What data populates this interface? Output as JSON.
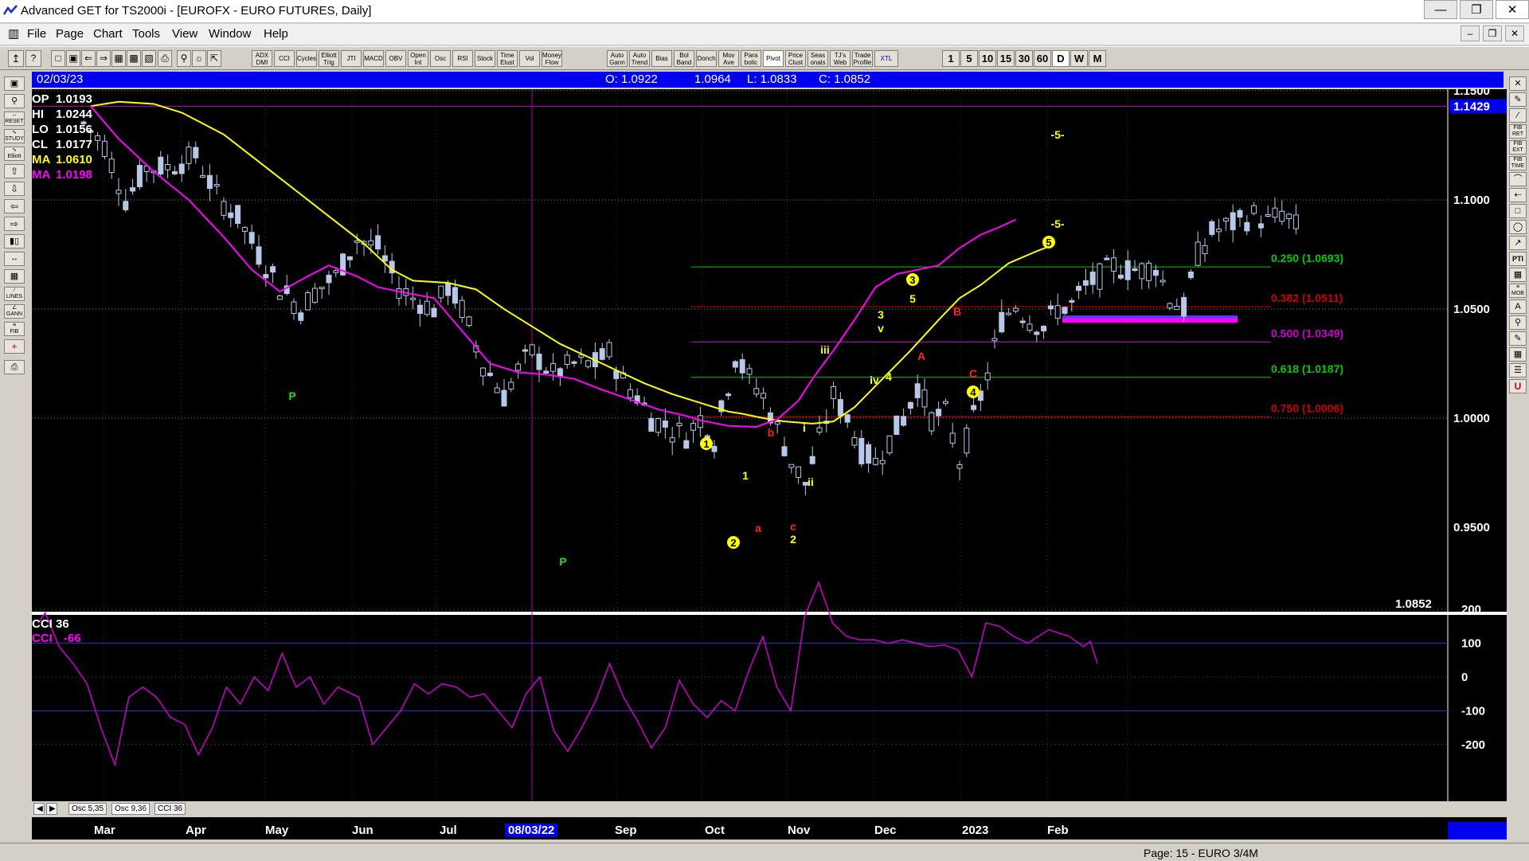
{
  "window": {
    "title": "Advanced GET for TS2000i - [EUROFX - EURO FUTURES, Daily]",
    "controls": [
      "minimize",
      "maximize",
      "close"
    ]
  },
  "menu": [
    "File",
    "Page",
    "Chart",
    "Tools",
    "View",
    "Window",
    "Help"
  ],
  "toolbar": {
    "studies": [
      "ADX DMI",
      "CCI",
      "Cycles",
      "Elliott Trig",
      "JTI",
      "MACD",
      "OBV",
      "Open Int",
      "Osc",
      "RSI",
      "Stock",
      "Time Elust",
      "Vol",
      "Money Flow",
      "Auto Gann",
      "Auto Trend",
      "Bias",
      "Bol Band",
      "Donch",
      "Mov Ave",
      "Para bolic",
      "Pivot",
      "Price Clust",
      "Seas onals",
      "TJ's Web",
      "Trade Profile",
      "XTL"
    ],
    "periods": [
      "1",
      "5",
      "10",
      "15",
      "30",
      "60",
      "D",
      "W",
      "M"
    ]
  },
  "info_bar": {
    "date": "02/03/23",
    "open_label": "O: 1.0922",
    "high_value": "1.0964",
    "low_label": "L: 1.0833",
    "close_label": "C: 1.0852"
  },
  "legend": [
    {
      "label": "OP",
      "value": "1.0193",
      "color": "#ffffff"
    },
    {
      "label": "HI",
      "value": "1.0244",
      "color": "#ffffff"
    },
    {
      "label": "LO",
      "value": "1.0156",
      "color": "#ffffff"
    },
    {
      "label": "CL",
      "value": "1.0177",
      "color": "#ffffff"
    },
    {
      "label": "MA",
      "value": "1.0610",
      "color": "#ffff00"
    },
    {
      "label": "MA",
      "value": "1.0198",
      "color": "#ff00ff"
    }
  ],
  "price_axis": {
    "ticks": [
      "1.1500",
      "1.1000",
      "1.0500",
      "1.0000",
      "0.9500"
    ],
    "marker": "1.1429",
    "last": "1.0852"
  },
  "fib_levels": [
    {
      "label": "0.250 (1.0693)",
      "color": "#00cc00"
    },
    {
      "label": "0.382 (1.0511)",
      "color": "#cc0000"
    },
    {
      "label": "0.500 (1.0349)",
      "color": "#cc00cc"
    },
    {
      "label": "0.618 (1.0187)",
      "color": "#00cc00"
    },
    {
      "label": "0.750 (1.0006)",
      "color": "#cc0000"
    }
  ],
  "wave_labels": {
    "five_top": "-5-",
    "five_mid": "-5-",
    "circle_5": "5",
    "circle_3": "3",
    "five_small": "5",
    "three_small": "3",
    "v_small": "v",
    "iii": "iii",
    "iv": "iv",
    "four_small": "4",
    "i_small": "i",
    "ii_small": "ii",
    "circle_1": "1",
    "one_small": "1",
    "circle_2": "2",
    "two_small": "2",
    "c_small": "c",
    "b_small": "b",
    "a_small": "a",
    "A": "A",
    "B": "B",
    "C": "C",
    "circle_4": "4",
    "P1": "P",
    "P2": "P"
  },
  "indicator": {
    "title": "CCI 36",
    "line_label": "CCI",
    "line_value": "-66",
    "ticks": [
      "200",
      "100",
      "0",
      "-100",
      "-200"
    ]
  },
  "osc_tabs": [
    "Osc 5,35",
    "Osc 9,36",
    "CCI 36"
  ],
  "months": [
    "Mar",
    "Apr",
    "May",
    "Jun",
    "Jul",
    "08/03/22",
    "Sep",
    "Oct",
    "Nov",
    "Dec",
    "2023",
    "Feb"
  ],
  "status": {
    "page": "Page: 15 - EURO 3/4M"
  },
  "chart_data": {
    "type": "candlestick",
    "price_ylim": [
      0.95,
      1.15
    ],
    "ma_yellow": [
      [
        1,
        1.143
      ],
      [
        5,
        1.145
      ],
      [
        10,
        1.144
      ],
      [
        14,
        1.14
      ],
      [
        20,
        1.13
      ],
      [
        24,
        1.12
      ],
      [
        28,
        1.11
      ],
      [
        32,
        1.1
      ],
      [
        36,
        1.09
      ],
      [
        40,
        1.08
      ],
      [
        44,
        1.068
      ],
      [
        47,
        1.063
      ],
      [
        52,
        1.062
      ],
      [
        56,
        1.059
      ],
      [
        60,
        1.05
      ],
      [
        64,
        1.042
      ],
      [
        68,
        1.034
      ],
      [
        72,
        1.028
      ],
      [
        76,
        1.022
      ],
      [
        80,
        1.016
      ],
      [
        84,
        1.011
      ],
      [
        88,
        1.007
      ],
      [
        92,
        1.003
      ],
      [
        94,
        1.002
      ],
      [
        97,
        1.0
      ],
      [
        100,
        0.9985
      ],
      [
        104,
        0.9975
      ],
      [
        107,
        0.9985
      ],
      [
        110,
        1.005
      ],
      [
        114,
        1.018
      ],
      [
        118,
        1.031
      ],
      [
        122,
        1.045
      ],
      [
        125,
        1.055
      ],
      [
        128,
        1.061
      ],
      [
        132,
        1.071
      ],
      [
        136,
        1.0765
      ],
      [
        138,
        1.079
      ]
    ],
    "ma_magenta": [
      [
        1,
        1.143
      ],
      [
        5,
        1.128
      ],
      [
        10,
        1.113
      ],
      [
        15,
        1.1
      ],
      [
        20,
        1.083
      ],
      [
        24,
        1.068
      ],
      [
        28,
        1.058
      ],
      [
        32,
        1.065
      ],
      [
        35,
        1.07
      ],
      [
        39,
        1.065
      ],
      [
        42,
        1.06
      ],
      [
        45,
        1.058
      ],
      [
        50,
        1.055
      ],
      [
        54,
        1.04
      ],
      [
        58,
        1.025
      ],
      [
        62,
        1.021
      ],
      [
        66,
        1.02
      ],
      [
        70,
        1.018
      ],
      [
        74,
        1.013
      ],
      [
        78,
        1.0085
      ],
      [
        82,
        1.004
      ],
      [
        86,
        1.001
      ],
      [
        88,
        0.999
      ],
      [
        92,
        0.9965
      ],
      [
        96,
        0.996
      ],
      [
        99,
        0.9995
      ],
      [
        102,
        1.008
      ],
      [
        104,
        1.018
      ],
      [
        107,
        1.031
      ],
      [
        110,
        1.045
      ],
      [
        113,
        1.06
      ],
      [
        116,
        1.066
      ],
      [
        119,
        1.068
      ],
      [
        122,
        1.07
      ],
      [
        125,
        1.078
      ],
      [
        128,
        1.084
      ],
      [
        131,
        1.088
      ],
      [
        133,
        1.091
      ]
    ],
    "cci": [
      [
        0,
        160
      ],
      [
        1,
        190
      ],
      [
        3,
        90
      ],
      [
        5,
        40
      ],
      [
        7,
        -20
      ],
      [
        9,
        -150
      ],
      [
        11,
        -260
      ],
      [
        13,
        -60
      ],
      [
        15,
        -30
      ],
      [
        17,
        -60
      ],
      [
        19,
        -120
      ],
      [
        21,
        -140
      ],
      [
        23,
        -230
      ],
      [
        25,
        -150
      ],
      [
        27,
        -30
      ],
      [
        29,
        -80
      ],
      [
        31,
        0
      ],
      [
        33,
        -40
      ],
      [
        35,
        70
      ],
      [
        37,
        -30
      ],
      [
        39,
        0
      ],
      [
        41,
        -80
      ],
      [
        43,
        -30
      ],
      [
        46,
        -60
      ],
      [
        48,
        -200
      ],
      [
        50,
        -150
      ],
      [
        52,
        -100
      ],
      [
        54,
        -20
      ],
      [
        56,
        -50
      ],
      [
        58,
        -20
      ],
      [
        60,
        -30
      ],
      [
        62,
        -60
      ],
      [
        64,
        -50
      ],
      [
        66,
        -100
      ],
      [
        68,
        -150
      ],
      [
        70,
        -50
      ],
      [
        72,
        0
      ],
      [
        74,
        -160
      ],
      [
        76,
        -220
      ],
      [
        78,
        -150
      ],
      [
        80,
        -70
      ],
      [
        82,
        40
      ],
      [
        84,
        -60
      ],
      [
        86,
        -130
      ],
      [
        88,
        -210
      ],
      [
        90,
        -150
      ],
      [
        92,
        -10
      ],
      [
        94,
        -80
      ],
      [
        96,
        -120
      ],
      [
        98,
        -70
      ],
      [
        100,
        -100
      ],
      [
        102,
        20
      ],
      [
        104,
        120
      ],
      [
        106,
        -30
      ],
      [
        108,
        -100
      ],
      [
        110,
        180
      ],
      [
        112,
        280
      ],
      [
        114,
        160
      ],
      [
        116,
        120
      ],
      [
        118,
        110
      ],
      [
        120,
        110
      ],
      [
        122,
        100
      ],
      [
        124,
        110
      ],
      [
        126,
        100
      ],
      [
        128,
        90
      ],
      [
        130,
        95
      ],
      [
        132,
        80
      ],
      [
        134,
        0
      ],
      [
        136,
        160
      ],
      [
        138,
        150
      ],
      [
        140,
        120
      ],
      [
        142,
        100
      ],
      [
        145,
        140
      ],
      [
        148,
        120
      ],
      [
        150,
        90
      ],
      [
        151,
        105
      ],
      [
        152,
        40
      ]
    ]
  }
}
